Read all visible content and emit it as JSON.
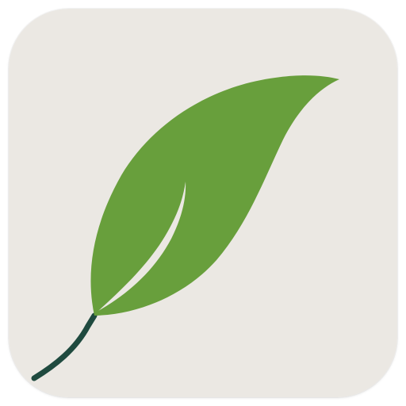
{
  "icon": {
    "name": "leaf-app-icon",
    "symbol": "leaf-icon",
    "colors": {
      "background": "#ebe8e3",
      "leaf": "#689f3c",
      "vein": "#ebe8e3",
      "stem": "#1f4a3f"
    }
  }
}
